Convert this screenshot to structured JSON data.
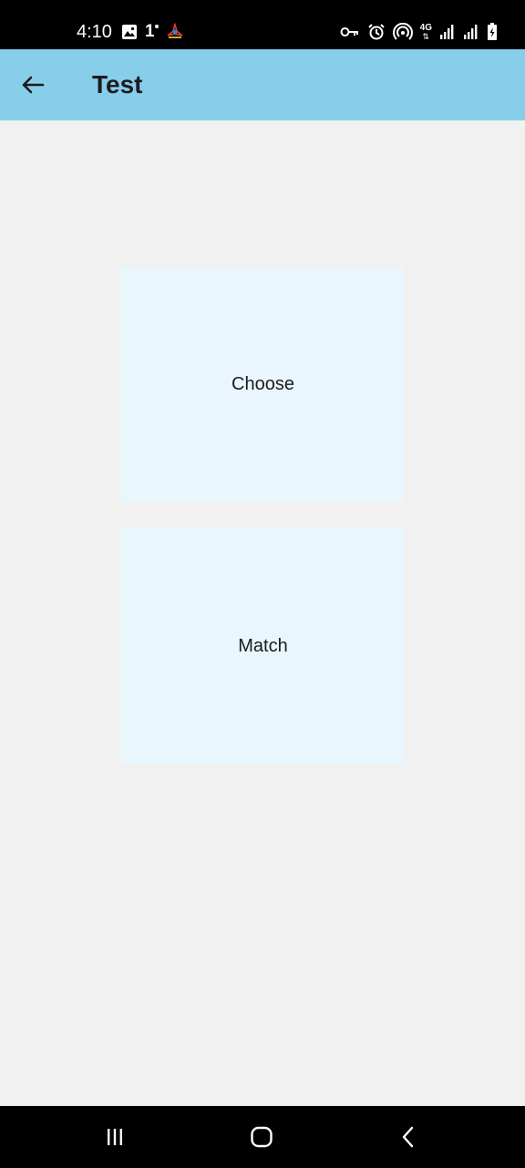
{
  "status_bar": {
    "time": "4:10",
    "extra_text": "1",
    "network_label": "4G",
    "left_icons": [
      "image-icon",
      "notification-1-icon",
      "app-logo-icon"
    ],
    "right_icons": [
      "vpn-key-icon",
      "alarm-icon",
      "hotspot-icon",
      "network-4g-icon",
      "signal-icon",
      "signal-icon",
      "battery-icon"
    ]
  },
  "app_bar": {
    "title": "Test",
    "background_color": "#87ceeb",
    "back_icon": "arrow-left-icon"
  },
  "cards": [
    {
      "label": "Choose",
      "background_color": "#eaf6fd"
    },
    {
      "label": "Match",
      "background_color": "#eaf6fd"
    }
  ],
  "nav_bar": {
    "buttons": [
      "recents-icon",
      "home-icon",
      "back-chevron-icon"
    ]
  }
}
